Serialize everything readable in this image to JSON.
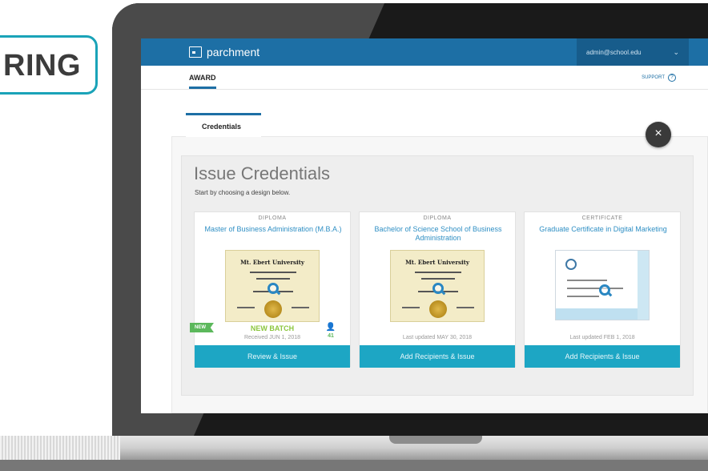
{
  "badge": {
    "text": "RING"
  },
  "app": {
    "logo_text": "parchment",
    "user_email": "admin@school.edu",
    "nav_tab": "AWARD",
    "support_label": "SUPPORT",
    "help_icon": "?"
  },
  "tabs": [
    {
      "label": "Credentials"
    }
  ],
  "issue": {
    "title": "Issue Credentials",
    "subtitle": "Start by choosing a design below.",
    "close_icon": "×"
  },
  "cards": [
    {
      "type": "DIPLOMA",
      "name": "Master of Business Administration (M.B.A.)",
      "doc_heading": "Mt. Ebert University",
      "badge_new": "NEW",
      "batch_label": "NEW BATCH",
      "meta": "Received JUN 1, 2018",
      "recipient_count": "41",
      "button": "Review & Issue"
    },
    {
      "type": "DIPLOMA",
      "name": "Bachelor of Science School of Business Administration",
      "doc_heading": "Mt. Ebert University",
      "meta": "Last updated MAY 30, 2018",
      "button": "Add Recipients & Issue"
    },
    {
      "type": "CERTIFICATE",
      "name": "Graduate Certificate in Digital Marketing",
      "meta": "Last updated FEB 1, 2018",
      "button": "Add Recipients & Issue"
    }
  ]
}
